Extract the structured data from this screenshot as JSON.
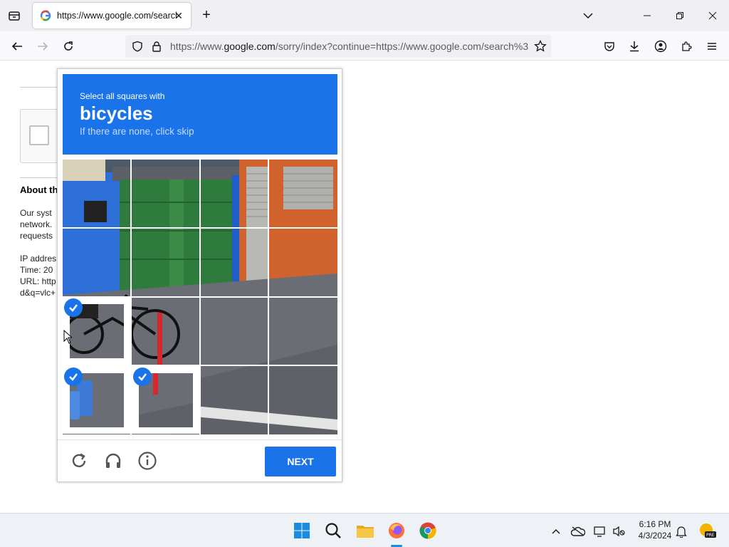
{
  "browser": {
    "tab": {
      "favicon": "G",
      "title": "https://www.google.com/search"
    },
    "url": {
      "prefix": "https://www.",
      "domain": "google.com",
      "rest": "/sorry/index?continue=https://www.google.com/search%3"
    }
  },
  "page": {
    "about_heading": "About th",
    "body_lines": [
      "Our syst",
      "network.",
      "requests"
    ],
    "info_lines": [
      "IP addres",
      "Time: 20",
      "URL: http",
      "d&q=vlc+"
    ]
  },
  "captcha": {
    "instruction": "Select all squares with",
    "target": "bicycles",
    "hint": "If there are none, click skip",
    "next_label": "NEXT",
    "selected_tiles": [
      8,
      12,
      13
    ],
    "colors": {
      "accent": "#1a73e8"
    }
  },
  "taskbar": {
    "time": "6:16 PM",
    "date": "4/3/2024",
    "apps": [
      "windows-start",
      "search",
      "file-explorer",
      "firefox",
      "chrome"
    ]
  }
}
